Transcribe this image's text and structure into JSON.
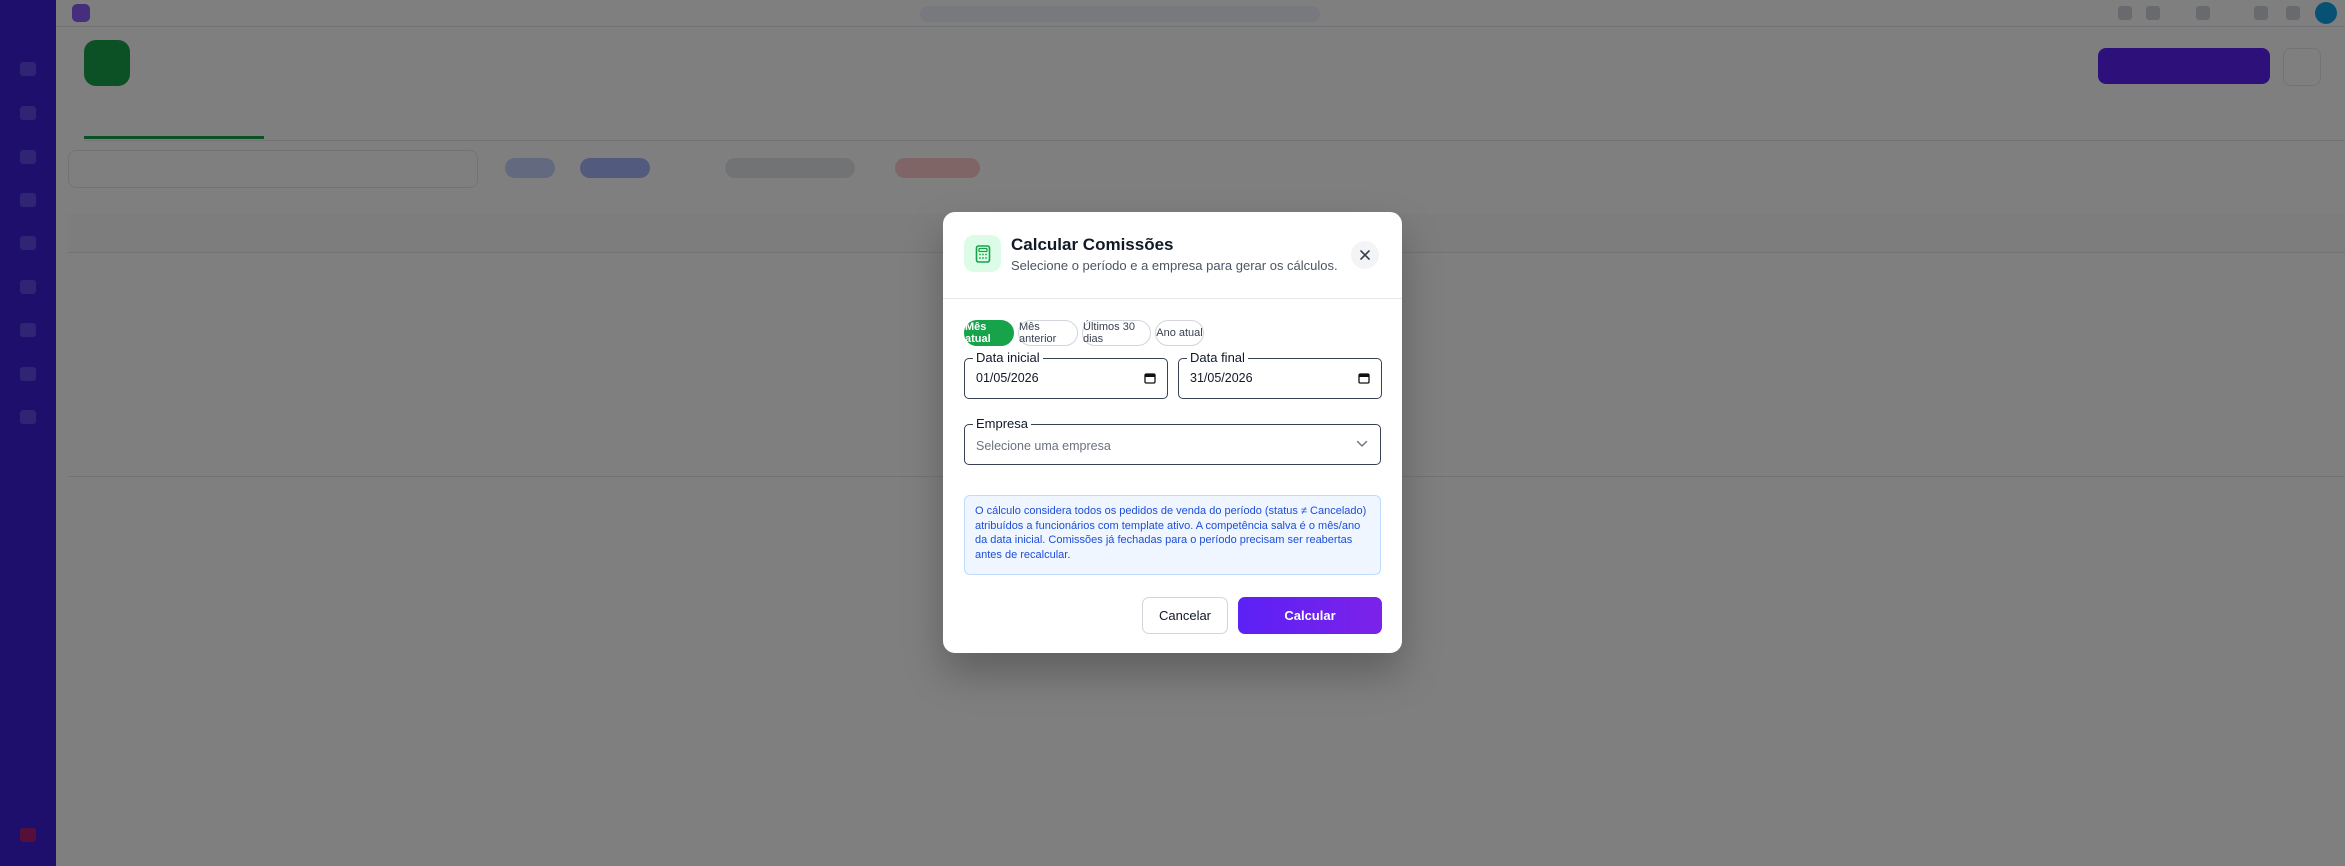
{
  "modal": {
    "title": "Calcular Comissões",
    "subtitle": "Selecione o período e a empresa para gerar os cálculos.",
    "header_icon": "calculator-icon",
    "close_icon": "close-icon",
    "period_presets": [
      {
        "label": "Mês atual",
        "active": true
      },
      {
        "label": "Mês anterior",
        "active": false
      },
      {
        "label": "Últimos 30 dias",
        "active": false
      },
      {
        "label": "Ano atual",
        "active": false
      }
    ],
    "start_date": {
      "label": "Data inicial",
      "value": "01/05/2026",
      "icon": "calendar-icon"
    },
    "end_date": {
      "label": "Data final",
      "value": "31/05/2026",
      "icon": "calendar-icon"
    },
    "company": {
      "label": "Empresa",
      "placeholder": "Selecione uma empresa",
      "icon": "chevron-down-icon"
    },
    "info_text": "O cálculo considera todos os pedidos de venda do período (status ≠ Cancelado) atribuídos a funcionários com template ativo. A competência salva é o mês/ano da data inicial. Comissões já fechadas para o período precisam ser reabertas antes de recalcular.",
    "cancel_label": "Cancelar",
    "submit_label": "Calcular"
  },
  "colors": {
    "accent_green": "#16a34a",
    "primary_purple": "#5b21f5",
    "sidebar": "#3b1ed6",
    "info_text": "#1d4ed8",
    "overlay": "rgba(0,0,0,0.5)"
  }
}
